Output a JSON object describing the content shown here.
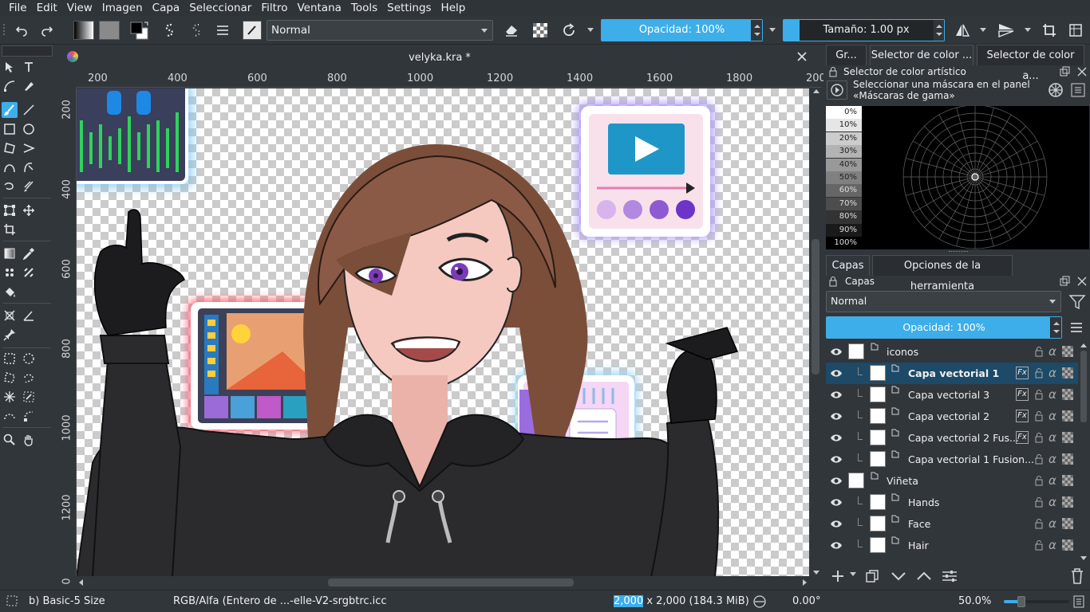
{
  "menu": [
    "File",
    "Edit",
    "View",
    "Imagen",
    "Capa",
    "Seleccionar",
    "Filtro",
    "Ventana",
    "Tools",
    "Settings",
    "Help"
  ],
  "toolbar": {
    "blend_mode": "Normal",
    "opacity_label": "Opacidad: 100%",
    "opacity_value": 1.0,
    "size_label": "Tamaño: 1.00 px"
  },
  "document": {
    "tab_title": "velyka.kra *",
    "ruler_h": [
      "200",
      "400",
      "600",
      "800",
      "1000",
      "1200",
      "1400",
      "1600",
      "1800",
      "200"
    ],
    "ruler_v": [
      "200",
      "400",
      "600",
      "800",
      "1000",
      "1200",
      "0"
    ]
  },
  "right_panel": {
    "top_tabs": [
      "Gr...",
      "Selector de color ...",
      "Selector de color a..."
    ],
    "artistic_selector_title": "Selector de color artístico",
    "mask_hint": "Seleccionar una máscara en el panel «Máscaras de gama»",
    "gray_steps": [
      "0%",
      "10%",
      "20%",
      "30%",
      "40%",
      "50%",
      "60%",
      "70%",
      "80%",
      "90%",
      "100%"
    ],
    "gray_colors": [
      "#ffffff",
      "#e6e6e6",
      "#cccccc",
      "#b3b3b3",
      "#999999",
      "#808080",
      "#666666",
      "#4d4d4d",
      "#333333",
      "#1a1a1a",
      "#000000"
    ],
    "bottom_tabs": [
      "Capas",
      "Opciones de la herramienta"
    ],
    "layers_title": "Capas",
    "layer_blend": "Normal",
    "layer_opacity_label": "Opacidad:  100%",
    "layers": [
      {
        "name": "iconos",
        "indent": 0,
        "group": true,
        "selected": false,
        "fx": false
      },
      {
        "name": "Capa vectorial 1",
        "indent": 1,
        "group": false,
        "selected": true,
        "fx": true
      },
      {
        "name": "Capa vectorial 3",
        "indent": 1,
        "group": false,
        "selected": false,
        "fx": true
      },
      {
        "name": "Capa vectorial 2",
        "indent": 1,
        "group": false,
        "selected": false,
        "fx": true
      },
      {
        "name": "Capa vectorial 2 Fus...",
        "indent": 1,
        "group": false,
        "selected": false,
        "fx": true
      },
      {
        "name": "Capa vectorial 1 Fusion...",
        "indent": 1,
        "group": false,
        "selected": false,
        "fx": false
      },
      {
        "name": "Viñeta",
        "indent": 0,
        "group": true,
        "selected": false,
        "fx": false
      },
      {
        "name": "Hands",
        "indent": 1,
        "group": false,
        "selected": false,
        "fx": false
      },
      {
        "name": "Face",
        "indent": 1,
        "group": false,
        "selected": false,
        "fx": false
      },
      {
        "name": "Hair",
        "indent": 1,
        "group": false,
        "selected": false,
        "fx": false
      }
    ]
  },
  "status": {
    "brush": "b) Basic-5 Size",
    "color_profile": "RGB/Alfa (Entero de ...-elle-V2-srgbtrc.icc",
    "dimensions_sel": "2,000",
    "dimensions_rest": " x 2,000 (184.3 MiB)",
    "rotation": "0.00°",
    "zoom": "50.0%"
  },
  "colors": {
    "accent": "#3daee9",
    "bg": "#31363b",
    "selected_row": "#1d4a66"
  }
}
